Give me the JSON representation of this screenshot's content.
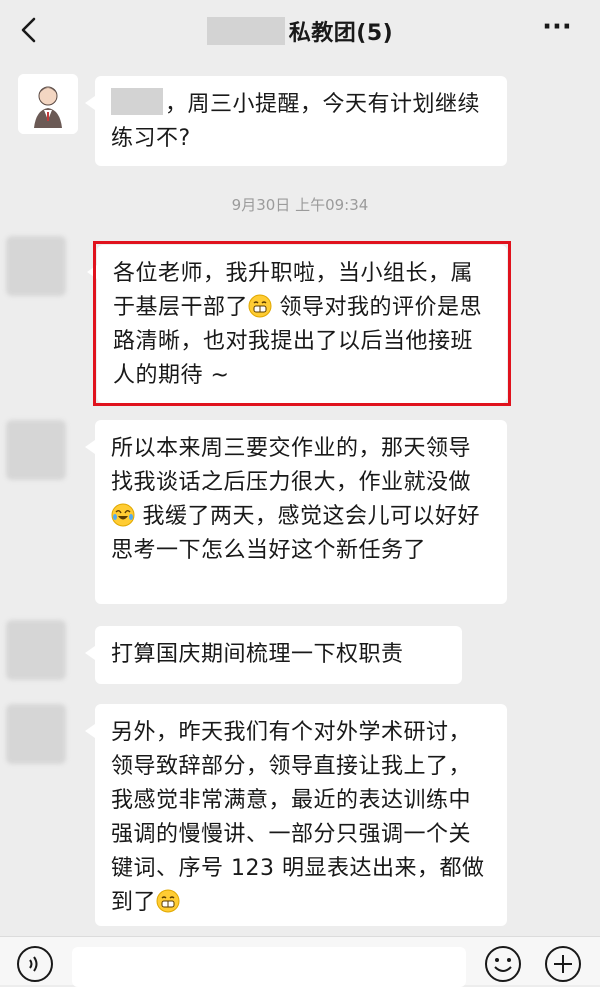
{
  "header": {
    "title": "私教团(5)",
    "more": "···"
  },
  "timestamp": "9月30日 上午09:34",
  "messages": [
    {
      "text1": "，周三小提醒，今天有计划继续练习不?"
    },
    {
      "text1": "各位老师，我升职啦，当小组长，属于基层干部了",
      "text2": " 领导对我的评价是思路清晰，也对我提出了以后当他接班人的期待 ~"
    },
    {
      "text1": "所以本来周三要交作业的，那天领导找我谈话之后压力很大，作业就没做",
      "text2": " 我缓了两天，感觉这会儿可以好好思考一下怎么当好这个新任务了"
    },
    {
      "text1": "打算国庆期间梳理一下权职责"
    },
    {
      "text1": "另外，昨天我们有个对外学术研讨，领导致辞部分，领导直接让我上了，我感觉非常满意，最近的表达训练中强调的慢慢讲、一部分只强调一个关键词、序号 123 明显表达出来，都做到了"
    }
  ],
  "icons": {
    "back": "chevron-left-icon",
    "more": "more-dots-icon",
    "voice": "voice-icon",
    "emoji": "emoji-icon",
    "plus": "plus-icon"
  },
  "colors": {
    "background": "#ededed",
    "bubble": "#ffffff",
    "highlight": "#e0121d",
    "timestamp": "#9b9b9b"
  }
}
